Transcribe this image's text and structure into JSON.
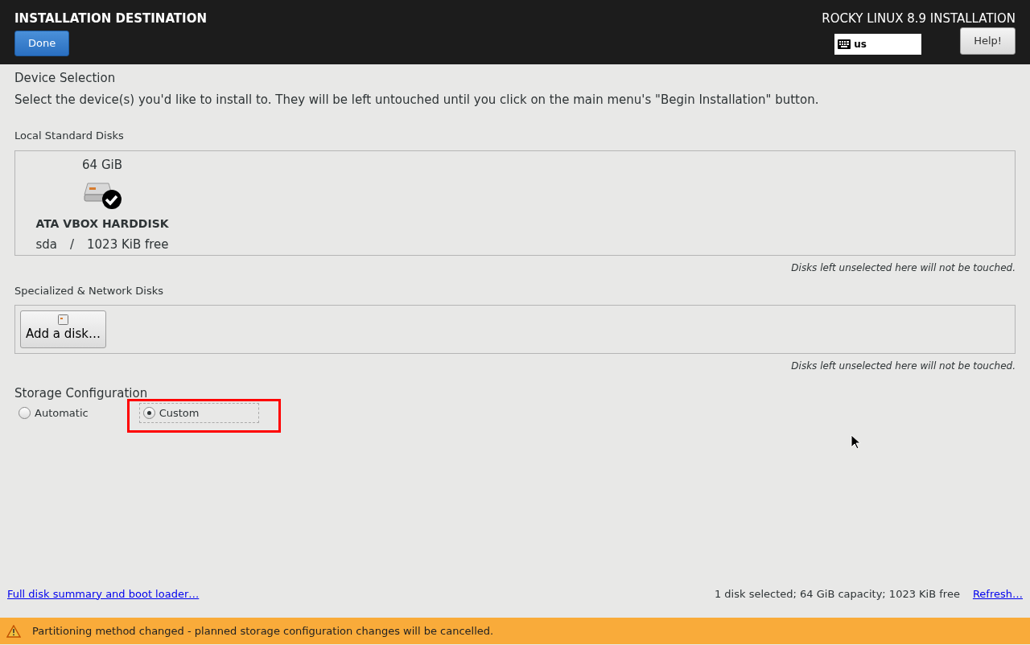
{
  "header": {
    "title": "INSTALLATION DESTINATION",
    "done_button": "Done",
    "product_title": "ROCKY LINUX 8.9 INSTALLATION",
    "keyboard_layout": "us",
    "help_button": "Help!"
  },
  "device_selection": {
    "heading": "Device Selection",
    "description": "Select the device(s) you'd like to install to.  They will be left untouched until you click on the main menu's \"Begin Installation\" button."
  },
  "local_disks": {
    "heading": "Local Standard Disks",
    "note": "Disks left unselected here will not be touched.",
    "disks": [
      {
        "size": "64 GiB",
        "name": "ATA VBOX HARDDISK",
        "device": "sda",
        "separator": "/",
        "free": "1023 KiB free",
        "selected": true
      }
    ]
  },
  "specialized_disks": {
    "heading": "Specialized & Network Disks",
    "add_button": "Add a disk…",
    "note": "Disks left unselected here will not be touched."
  },
  "storage_configuration": {
    "heading": "Storage Configuration",
    "options": [
      {
        "label": "Automatic",
        "selected": false,
        "highlighted": false
      },
      {
        "label": "Custom",
        "selected": true,
        "highlighted": true
      }
    ]
  },
  "footer": {
    "summary_link": "Full disk summary and boot loader…",
    "summary": "1 disk selected; 64 GiB capacity; 1023 KiB free",
    "refresh_link": "Refresh…"
  },
  "warning_bar": {
    "message": "Partitioning method changed - planned storage configuration changes will be cancelled."
  }
}
